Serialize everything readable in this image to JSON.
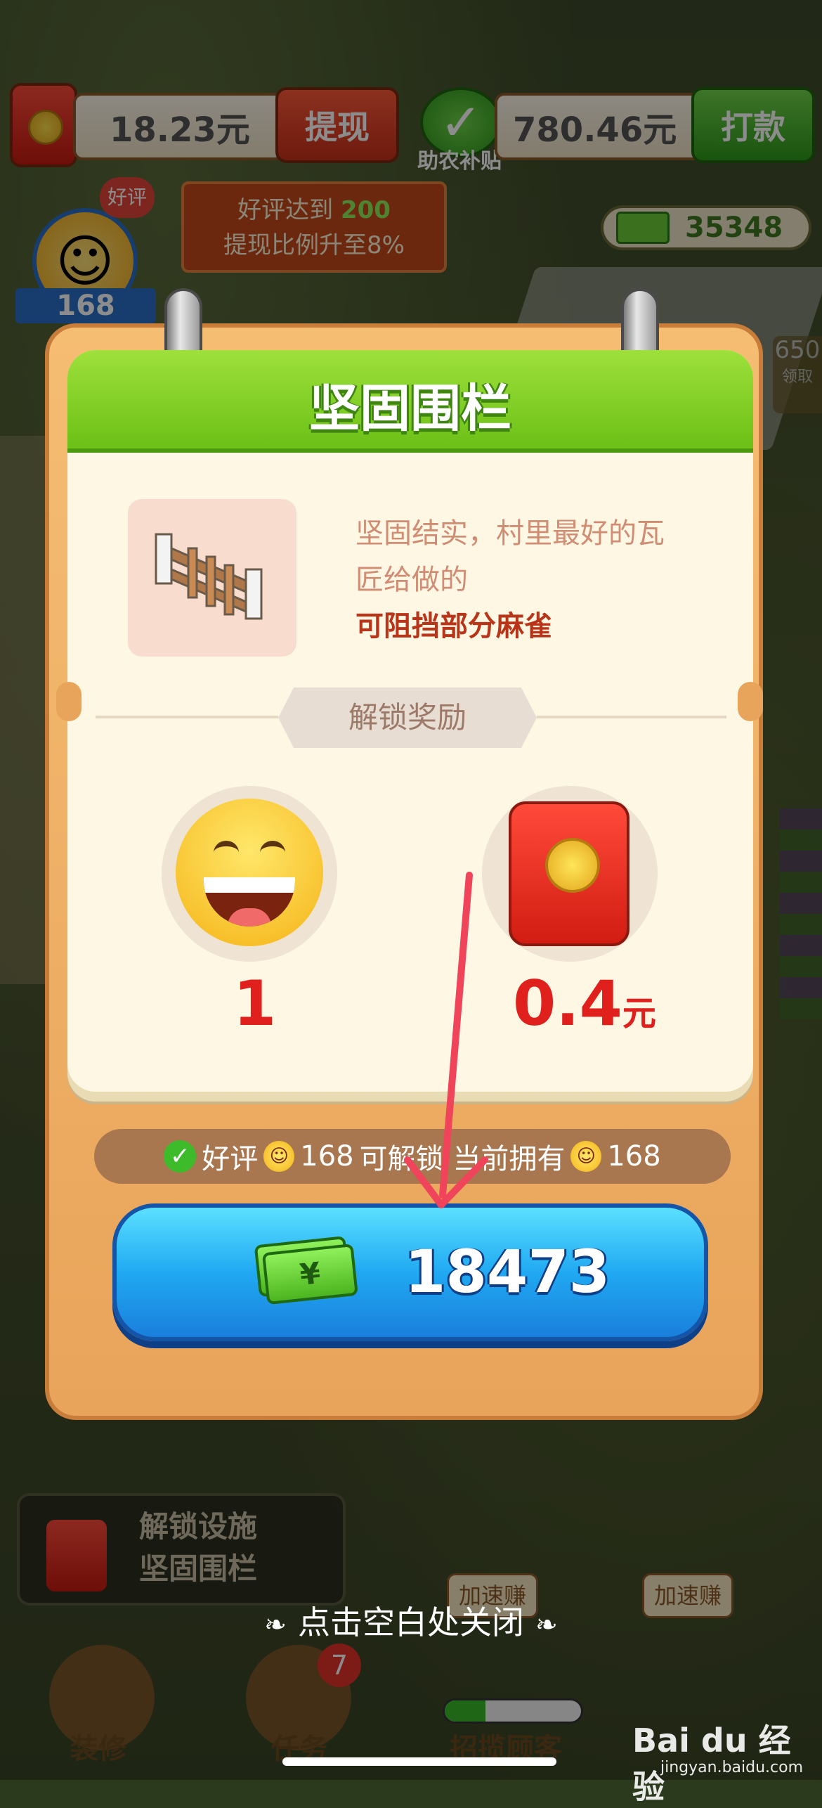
{
  "hud": {
    "balance": "18.23元",
    "withdraw_label": "提现",
    "subsidy_label": "助农补贴",
    "subsidy_value": "780.46元",
    "pay_label": "打款",
    "tip_line1_prefix": "好评达到",
    "tip_line1_value": "200",
    "tip_line2": "提现比例升至8%",
    "cash_count": "35348",
    "avatar_level": "168",
    "avatar_tag": "好评",
    "side_count": "650",
    "side_label": "领取"
  },
  "dialog": {
    "title": "坚固围栏",
    "desc_line1": "坚固结实，村里最好的瓦",
    "desc_line2": "匠给做的",
    "desc_emphasis": "可阻挡部分麻雀",
    "reward_banner": "解锁奖励",
    "rewards": [
      {
        "icon": "smiley-face-icon",
        "value": "1",
        "unit": ""
      },
      {
        "icon": "red-packet-icon",
        "value": "0.4",
        "unit": "元"
      }
    ],
    "requirement_prefix": "好评",
    "requirement_value": "168",
    "requirement_mid": "可解锁 当前拥有",
    "requirement_owned": "168",
    "price": "18473"
  },
  "bottom": {
    "unlock_line1": "解锁设施",
    "unlock_line2": "坚固围栏",
    "close_hint": "点击空白处关闭",
    "speed_label": "加速赚",
    "nav_decorate": "装修",
    "nav_task": "任务",
    "task_badge": "7",
    "nav_recruit": "招揽顾客",
    "progress": 0.3
  },
  "watermark": {
    "brand": "Bai du 经验",
    "url": "jingyan.baidu.com"
  },
  "colors": {
    "accent_green": "#6cc017",
    "button_blue": "#20a9f2",
    "reward_red": "#e0201c",
    "card_orange": "#e8a45a"
  }
}
